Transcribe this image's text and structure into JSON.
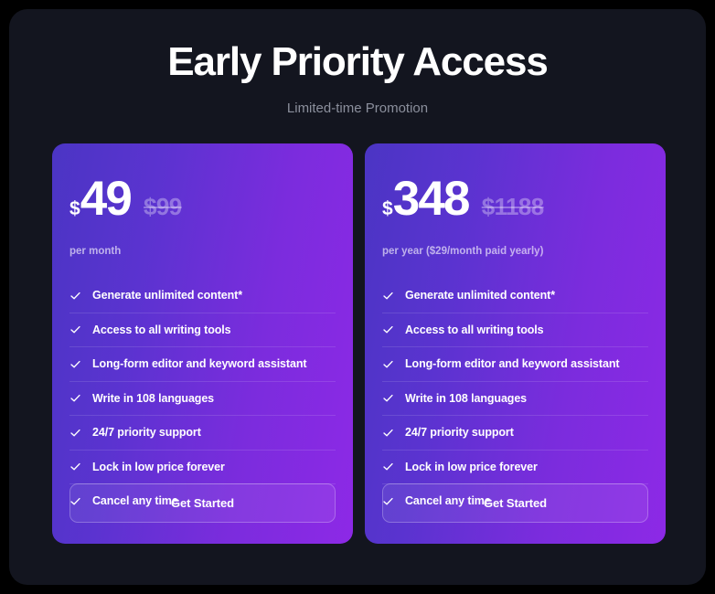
{
  "header": {
    "title": "Early Priority Access",
    "subtitle": "Limited-time Promotion"
  },
  "colors": {
    "page_background": "#13151f",
    "outer_frame": "#000000",
    "card_gradient_start": "#4b35c4",
    "card_gradient_end": "#8d29e6",
    "title_text": "#ffffff",
    "subtitle_text": "#8b8f9c"
  },
  "plans": [
    {
      "currency_symbol": "$",
      "price": "49",
      "original_price": "$99",
      "period": "per month",
      "features": [
        "Generate unlimited content*",
        "Access to all writing tools",
        "Long-form editor and keyword assistant",
        "Write in 108 languages",
        "24/7 priority support",
        "Lock in low price forever",
        "Cancel any time"
      ],
      "cta_label": "Get Started"
    },
    {
      "currency_symbol": "$",
      "price": "348",
      "original_price": "$1188",
      "period": "per year ($29/month paid yearly)",
      "features": [
        "Generate unlimited content*",
        "Access to all writing tools",
        "Long-form editor and keyword assistant",
        "Write in 108 languages",
        "24/7 priority support",
        "Lock in low price forever",
        "Cancel any time"
      ],
      "cta_label": "Get Started"
    }
  ]
}
